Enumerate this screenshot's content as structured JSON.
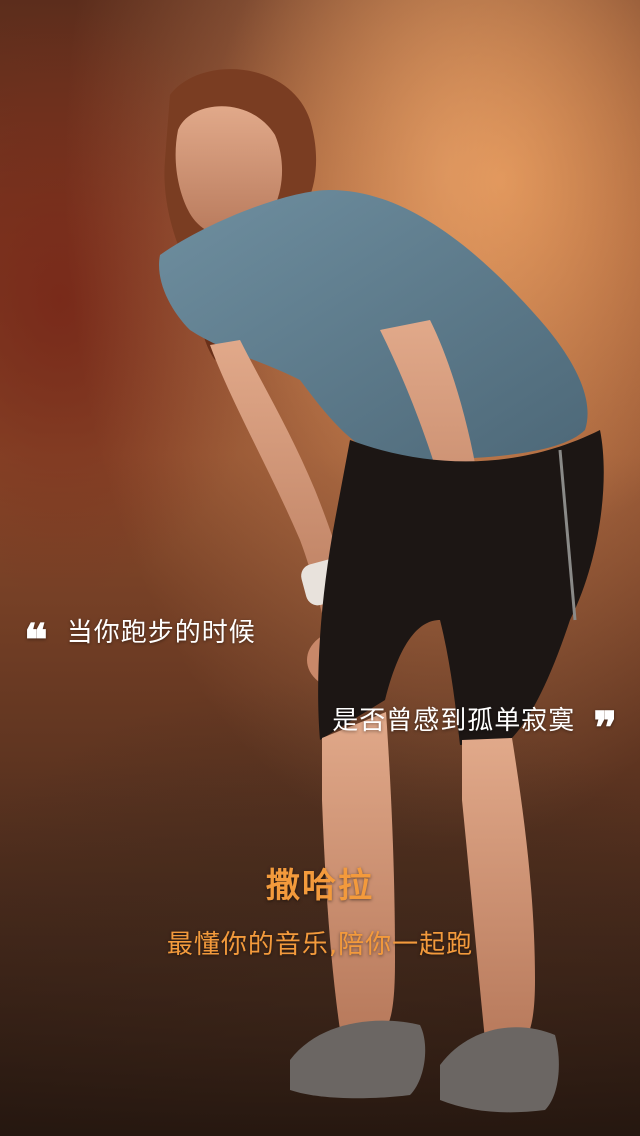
{
  "quote": {
    "open_mark": "❝",
    "line1": "当你跑步的时候",
    "line2": "是否曾感到孤单寂寞",
    "close_mark": "❞"
  },
  "brand": {
    "name": "撒哈拉",
    "slogan": "最懂你的音乐,陪你一起跑"
  },
  "colors": {
    "accent": "#f39a3c",
    "quote_text": "#ffffff"
  },
  "background": {
    "subject": "runner-photo"
  }
}
